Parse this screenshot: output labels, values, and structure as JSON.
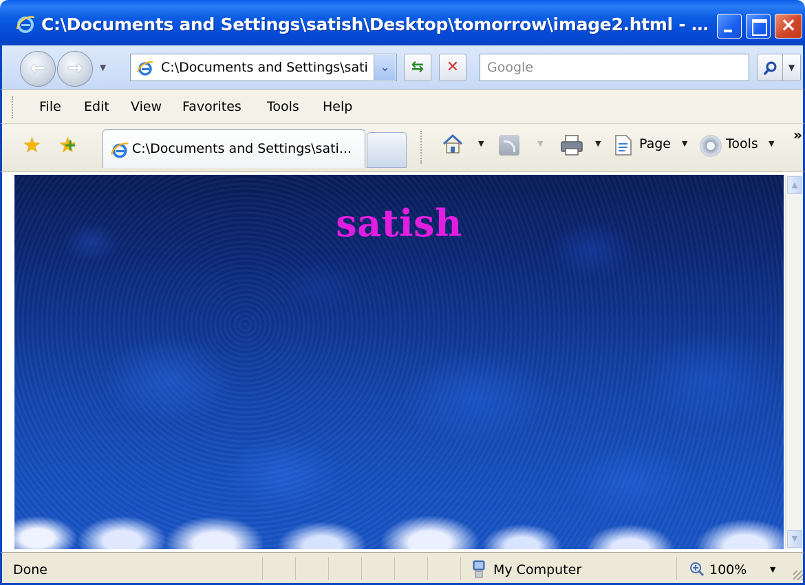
{
  "window": {
    "title": "C:\\Documents and Settings\\satish\\Desktop\\tomorrow\\image2.html - Window..."
  },
  "address_bar": {
    "value": "C:\\Documents and Settings\\sati:"
  },
  "search": {
    "placeholder": "Google"
  },
  "menu": {
    "items": [
      "File",
      "Edit",
      "View",
      "Favorites",
      "Tools",
      "Help"
    ]
  },
  "tab": {
    "label": "C:\\Documents and Settings\\sati..."
  },
  "command_bar": {
    "page_label": "Page",
    "tools_label": "Tools"
  },
  "content": {
    "heading": "satish",
    "heading_color": "#e01ee0"
  },
  "status_bar": {
    "status": "Done",
    "zone": "My Computer",
    "zoom": "100%"
  },
  "colors": {
    "titlebar": "#0548d4",
    "frame": "#0a45c2",
    "chrome": "#ece9d8"
  }
}
